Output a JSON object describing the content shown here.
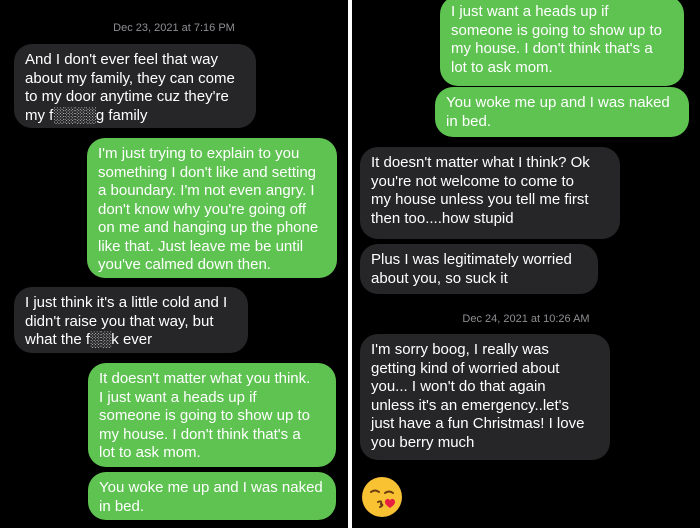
{
  "colors": {
    "background": "#000000",
    "incoming_bubble": "#262628",
    "outgoing_bubble": "#5fc352",
    "timestamp": "#8e8e93",
    "text": "#ffffff"
  },
  "left_panel": {
    "timestamp": "Dec 23, 2021 at 7:16 PM",
    "messages": [
      {
        "side": "incoming",
        "text": "And I don't ever feel that way\nabout my family, they can come\nto my door anytime cuz they're\nmy f░░░░g family"
      },
      {
        "side": "outgoing",
        "text": "I'm just trying to explain to you\nsomething I don't like and setting\na boundary. I'm not even angry. I\ndon't know why you're going off\non me and hanging up the phone\nlike that. Just leave me be until\nyou've calmed down then."
      },
      {
        "side": "incoming",
        "text": "I just think it's a little cold and I\ndidn't raise you that way, but\nwhat the f░░k ever"
      },
      {
        "side": "outgoing",
        "text": "It doesn't matter what you think.\nI just want a heads up if\nsomeone is going to show up to\nmy house. I don't think that's a\nlot to ask mom."
      },
      {
        "side": "outgoing",
        "text": "You woke me up and I was naked\nin bed."
      }
    ]
  },
  "right_panel": {
    "messages_top": [
      {
        "side": "outgoing",
        "text": "I just want a heads up if\nsomeone is going to show up to\nmy house. I don't think that's a\nlot to ask mom."
      },
      {
        "side": "outgoing",
        "text": "You woke me up and I was naked\nin bed."
      },
      {
        "side": "incoming",
        "text": "It doesn't matter what I think? Ok\nyou're not welcome to come to\nmy house unless you tell me first\nthen too....how stupid"
      },
      {
        "side": "incoming",
        "text": "Plus I was legitimately worried\nabout you, so suck it"
      }
    ],
    "timestamp": "Dec 24, 2021 at 10:26 AM",
    "messages_bottom": [
      {
        "side": "incoming",
        "text": "I'm sorry boog, I really was\ngetting kind of worried about\nyou... I won't do that again\nunless it's an emergency..let's\njust have a fun Christmas! I love\nyou berry much"
      }
    ],
    "emoji_icon": "kissing-face-with-heart-icon"
  }
}
